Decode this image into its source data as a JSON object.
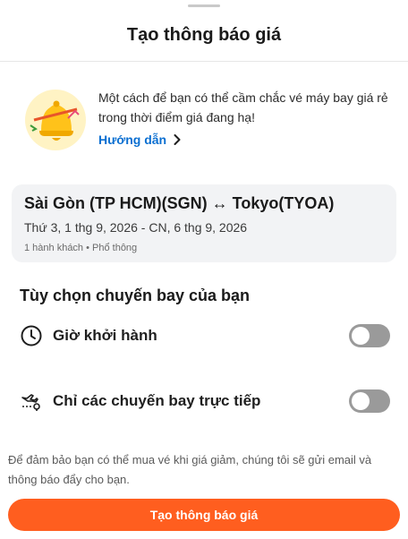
{
  "header": {
    "title": "Tạo thông báo giá"
  },
  "promo": {
    "description": "Một cách để bạn có thể cầm chắc vé máy bay giá rẻ trong thời điểm giá đang hạ!",
    "guide_label": "Hướng dẫn",
    "illustration": "bell-price-alert-icon"
  },
  "route": {
    "title": "Sài Gòn (TP HCM)(SGN) ↔ Tokyo(TYOA)",
    "dates": "Thứ 3, 1 thg 9, 2026 - CN, 6 thg 9, 2026",
    "meta": "1 hành khách • Phổ thông"
  },
  "options": {
    "title": "Tùy chọn chuyến bay của bạn",
    "items": [
      {
        "label": "Giờ khởi hành",
        "icon": "clock-icon",
        "enabled": false
      },
      {
        "label": "Chỉ các chuyến bay trực tiếp",
        "icon": "direct-flight-icon",
        "enabled": false
      }
    ]
  },
  "footer": {
    "note": "Để đảm bảo bạn có thể mua vé khi giá giảm, chúng tôi sẽ gửi email và thông báo đẩy cho bạn.",
    "cta_label": "Tạo thông báo giá"
  },
  "colors": {
    "accent": "#ff5e1f",
    "link": "#0b6fd1",
    "card_bg": "#f2f3f5",
    "toggle_off": "#9a9a9a"
  }
}
